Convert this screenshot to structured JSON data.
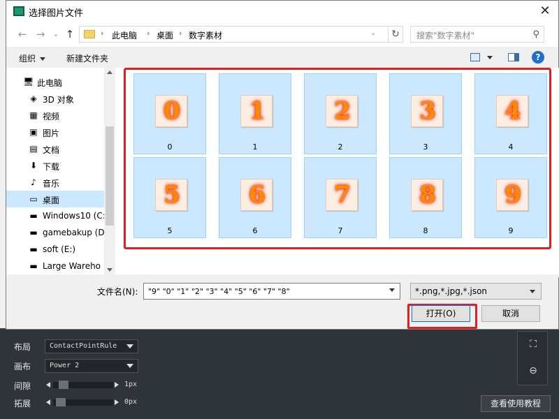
{
  "dialog": {
    "title": "选择图片文件",
    "close_glyph": "✕"
  },
  "address": {
    "back": "←",
    "forward": "→",
    "recent": "⌄",
    "up": "↑",
    "crumbs": [
      "此电脑",
      "桌面",
      "数字素材"
    ],
    "separator": "›",
    "refresh": "↻",
    "search_placeholder": "搜索\"数字素材\""
  },
  "toolbar": {
    "organize": "组织",
    "new_folder": "新建文件夹",
    "help": "?"
  },
  "nav": {
    "items": [
      {
        "label": "此电脑",
        "icon": "computer-icon",
        "glyph": "🖥"
      },
      {
        "label": "3D 对象",
        "icon": "cube-icon",
        "glyph": "◈"
      },
      {
        "label": "视频",
        "icon": "video-icon",
        "glyph": "▦"
      },
      {
        "label": "图片",
        "icon": "picture-icon",
        "glyph": "▣"
      },
      {
        "label": "文档",
        "icon": "document-icon",
        "glyph": "▤"
      },
      {
        "label": "下载",
        "icon": "download-icon",
        "glyph": "⬇"
      },
      {
        "label": "音乐",
        "icon": "music-icon",
        "glyph": "♪"
      },
      {
        "label": "桌面",
        "icon": "desktop-icon",
        "glyph": "▭"
      },
      {
        "label": "Windows10 (C:",
        "icon": "drive-icon",
        "glyph": "▬"
      },
      {
        "label": "gamebakup (D",
        "icon": "drive-icon",
        "glyph": "▬"
      },
      {
        "label": "soft (E:)",
        "icon": "drive-icon",
        "glyph": "▬"
      },
      {
        "label": "Large Wareho",
        "icon": "drive-icon",
        "glyph": "▬"
      }
    ],
    "selected_index": 7
  },
  "files": [
    "0",
    "1",
    "2",
    "3",
    "4",
    "5",
    "6",
    "7",
    "8",
    "9"
  ],
  "footer": {
    "filename_label": "文件名(N):",
    "filename_value": "\"9\" \"0\" \"1\" \"2\" \"3\" \"4\" \"5\" \"6\" \"7\" \"8\"",
    "filter": "*.png,*.jpg,*.json",
    "open": "打开(O)",
    "cancel": "取消"
  },
  "background_app": {
    "layout_label": "布局",
    "layout_value": "ContactPointRule",
    "canvas_label": "画布",
    "canvas_value": "Power 2",
    "spacing_label": "间隙",
    "spacing_value": "1px",
    "expand_label": "拓展",
    "expand_value": "0px",
    "tutorial": "查看使用教程",
    "fit_glyph": "⛶",
    "zoom_glyph": "⊖"
  },
  "colors": {
    "accent": "#0078d7",
    "highlight_frame": "#e02020",
    "selection": "#cce8ff"
  }
}
